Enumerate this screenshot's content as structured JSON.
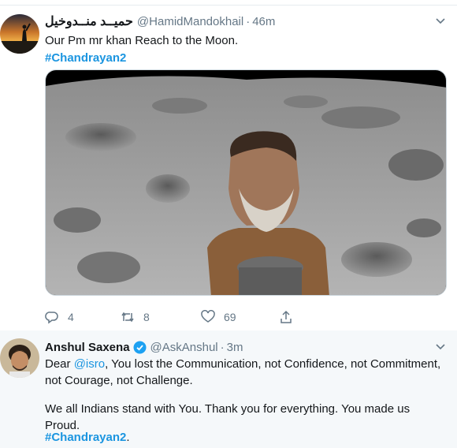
{
  "tweets": [
    {
      "display_name": "حمیــد منــدوخیل",
      "handle": "@HamidMandokhail",
      "separator": "·",
      "time": "46m",
      "text_line1": "Our Pm mr khan Reach to the Moon.",
      "hashtag": "#Chandrayan2",
      "stats": {
        "replies": "4",
        "retweets": "8",
        "likes": "69"
      }
    },
    {
      "display_name": "Anshul Saxena",
      "handle": "@AskAnshul",
      "separator": "·",
      "time": "3m",
      "verified": true,
      "line1_prefix": "Dear ",
      "mention": "@isro",
      "line1_suffix": ", You lost the Communication, not Confidence, not Commitment,",
      "line2": "not Courage, not Challenge.",
      "line3": "We all Indians stand with You. Thank you for everything. You made us Proud.",
      "hashtag": "#Chandrayan2",
      "hashtag_suffix": "."
    }
  ],
  "icons": {
    "reply": "reply-icon",
    "retweet": "retweet-icon",
    "like": "heart-icon",
    "share": "share-icon",
    "caret": "chevron-down-icon",
    "verified": "verified-badge-icon"
  },
  "colors": {
    "link": "#1b95e0",
    "secondary_text": "#657786",
    "primary_text": "#14171a",
    "highlight_bg": "#f5f8fa"
  }
}
